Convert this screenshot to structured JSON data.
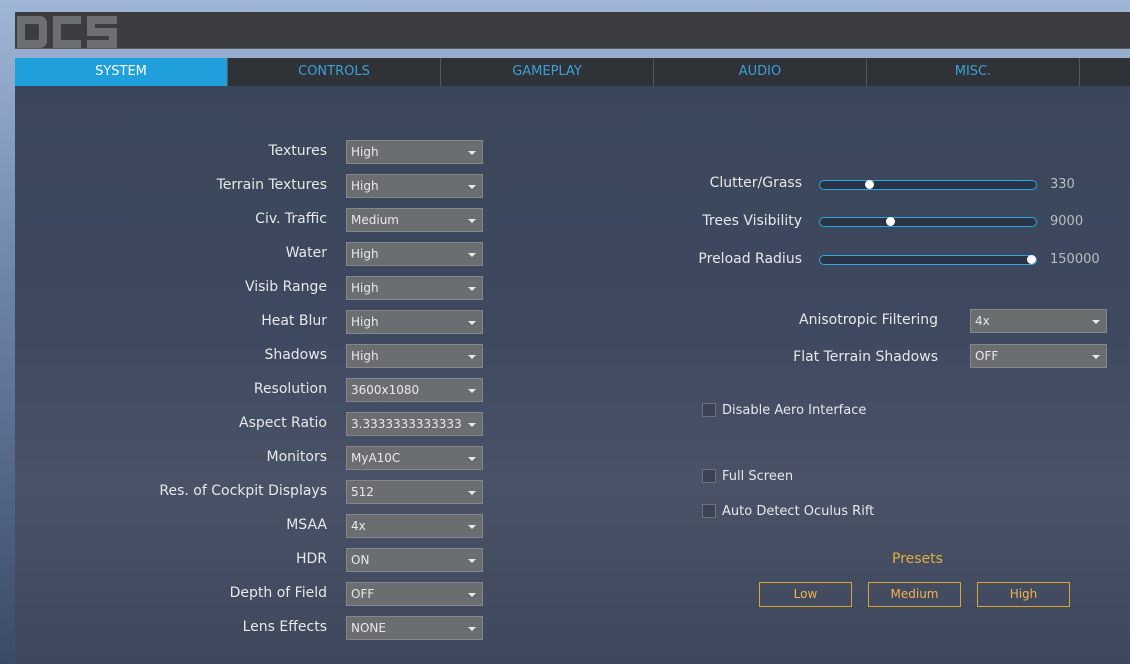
{
  "header": {
    "logo_text": "DCS"
  },
  "tabs": [
    {
      "label": "SYSTEM",
      "active": true
    },
    {
      "label": "CONTROLS",
      "active": false
    },
    {
      "label": "GAMEPLAY",
      "active": false
    },
    {
      "label": "AUDIO",
      "active": false
    },
    {
      "label": "MISC.",
      "active": false
    }
  ],
  "settings_left": [
    {
      "label": "Textures",
      "value": "High"
    },
    {
      "label": "Terrain Textures",
      "value": "High"
    },
    {
      "label": "Civ. Traffic",
      "value": "Medium"
    },
    {
      "label": "Water",
      "value": "High"
    },
    {
      "label": "Visib Range",
      "value": "High"
    },
    {
      "label": "Heat Blur",
      "value": "High"
    },
    {
      "label": "Shadows",
      "value": "High"
    },
    {
      "label": "Resolution",
      "value": "3600x1080"
    },
    {
      "label": "Aspect Ratio",
      "value": "3.3333333333333"
    },
    {
      "label": "Monitors",
      "value": "MyA10C"
    },
    {
      "label": "Res. of Cockpit Displays",
      "value": "512"
    },
    {
      "label": "MSAA",
      "value": "4x"
    },
    {
      "label": "HDR",
      "value": "ON"
    },
    {
      "label": "Depth of Field",
      "value": "OFF"
    },
    {
      "label": "Lens Effects",
      "value": "NONE"
    }
  ],
  "sliders": [
    {
      "label": "Clutter/Grass",
      "value": "330",
      "fraction": 0.23
    },
    {
      "label": "Trees Visibility",
      "value": "9000",
      "fraction": 0.33
    },
    {
      "label": "Preload Radius",
      "value": "150000",
      "fraction": 0.98
    }
  ],
  "settings_right": [
    {
      "label": "Anisotropic Filtering",
      "value": "4x"
    },
    {
      "label": "Flat Terrain Shadows",
      "value": "OFF"
    }
  ],
  "checkboxes": [
    {
      "label": "Disable Aero Interface",
      "checked": false
    },
    {
      "label": "Full Screen",
      "checked": false
    },
    {
      "label": "Auto Detect Oculus Rift",
      "checked": false
    }
  ],
  "presets": {
    "title": "Presets",
    "buttons": [
      "Low",
      "Medium",
      "High"
    ]
  },
  "colors": {
    "accent": "#1fa0dc",
    "preset": "#e0b040"
  }
}
